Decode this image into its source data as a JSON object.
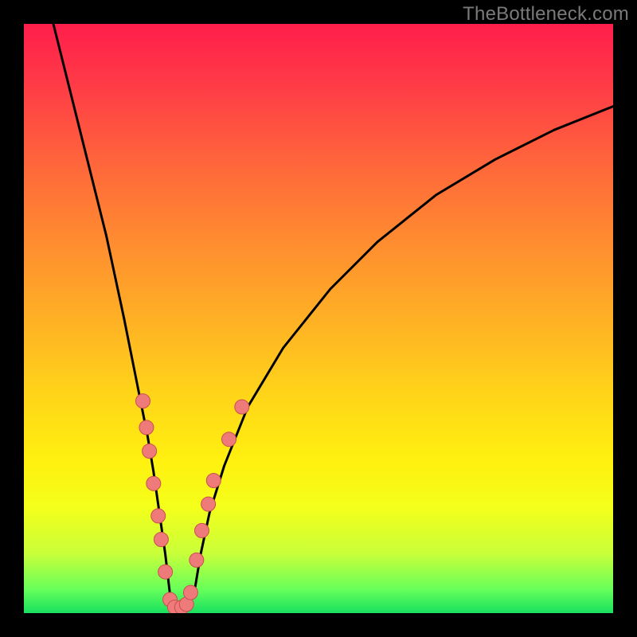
{
  "watermark": "TheBottleneck.com",
  "chart_data": {
    "type": "line",
    "title": "",
    "xlabel": "",
    "ylabel": "",
    "xlim": [
      0,
      100
    ],
    "ylim": [
      0,
      100
    ],
    "curve": {
      "description": "V-shaped bottleneck curve. Left branch descends from top-left; right branch ascends toward upper-right. Minimum near x≈25, y≈0.",
      "series": [
        {
          "name": "curve",
          "x_y": [
            [
              5,
              100
            ],
            [
              8,
              88
            ],
            [
              11,
              76
            ],
            [
              14,
              64
            ],
            [
              17,
              50
            ],
            [
              19,
              40
            ],
            [
              21,
              30
            ],
            [
              22,
              24
            ],
            [
              23,
              17
            ],
            [
              24,
              10
            ],
            [
              24.7,
              4
            ],
            [
              25,
              1.5
            ],
            [
              25.5,
              0.8
            ],
            [
              27,
              0.9
            ],
            [
              28,
              1.5
            ],
            [
              29,
              4
            ],
            [
              30,
              10
            ],
            [
              31.5,
              17
            ],
            [
              34,
              25
            ],
            [
              38,
              35
            ],
            [
              44,
              45
            ],
            [
              52,
              55
            ],
            [
              60,
              63
            ],
            [
              70,
              71
            ],
            [
              80,
              77
            ],
            [
              90,
              82
            ],
            [
              100,
              86
            ]
          ]
        }
      ]
    },
    "markers": {
      "color": "#ef7a7a",
      "stroke": "#c94f4f",
      "radius_px": 9,
      "points_xy": [
        [
          20.2,
          36.0
        ],
        [
          20.8,
          31.5
        ],
        [
          21.3,
          27.5
        ],
        [
          22.0,
          22.0
        ],
        [
          22.8,
          16.5
        ],
        [
          23.3,
          12.5
        ],
        [
          24.0,
          7.0
        ],
        [
          24.8,
          2.3
        ],
        [
          25.6,
          1.0
        ],
        [
          26.8,
          1.0
        ],
        [
          27.6,
          1.5
        ],
        [
          28.3,
          3.5
        ],
        [
          29.3,
          9.0
        ],
        [
          30.2,
          14.0
        ],
        [
          31.3,
          18.5
        ],
        [
          32.2,
          22.5
        ],
        [
          34.8,
          29.5
        ],
        [
          37.0,
          35.0
        ]
      ]
    }
  }
}
